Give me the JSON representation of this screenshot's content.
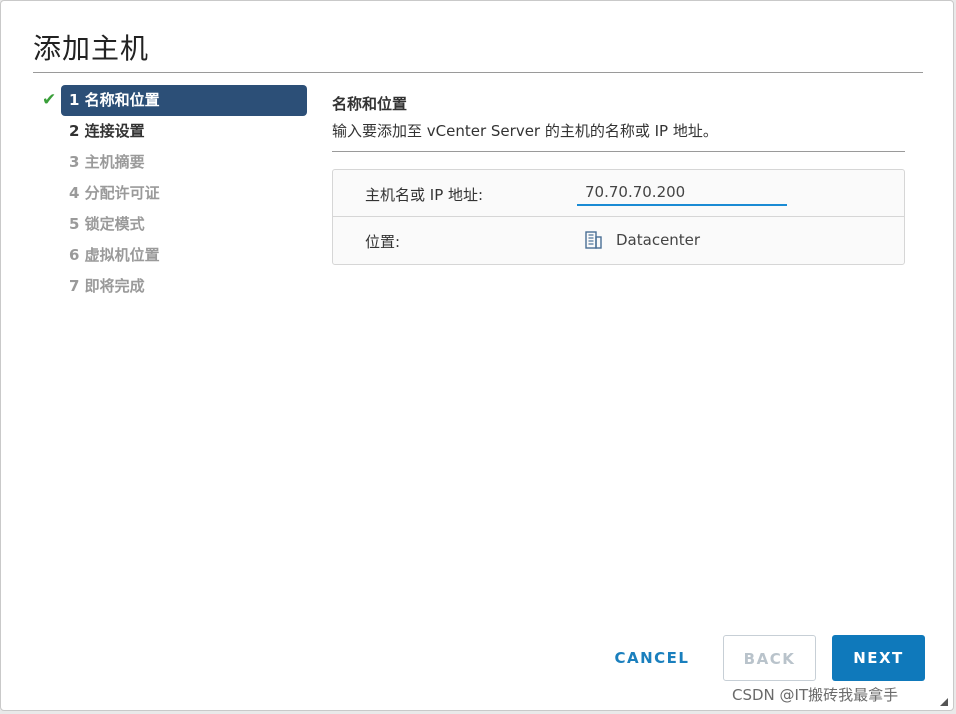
{
  "dialog": {
    "title": "添加主机"
  },
  "steps": [
    {
      "label": "1 名称和位置",
      "state": "active",
      "completed": true
    },
    {
      "label": "2 连接设置",
      "state": "enabled",
      "completed": false
    },
    {
      "label": "3 主机摘要",
      "state": "disabled",
      "completed": false
    },
    {
      "label": "4 分配许可证",
      "state": "disabled",
      "completed": false
    },
    {
      "label": "5 锁定模式",
      "state": "disabled",
      "completed": false
    },
    {
      "label": "6 虚拟机位置",
      "state": "disabled",
      "completed": false
    },
    {
      "label": "7 即将完成",
      "state": "disabled",
      "completed": false
    }
  ],
  "content": {
    "section_title": "名称和位置",
    "section_desc": "输入要添加至 vCenter Server 的主机的名称或 IP 地址。",
    "host_label": "主机名或 IP 地址:",
    "host_value": "70.70.70.200",
    "location_label": "位置:",
    "location_value": "Datacenter",
    "location_icon": "datacenter-icon"
  },
  "buttons": {
    "cancel": "CANCEL",
    "back": "BACK",
    "next": "NEXT"
  },
  "watermark": "CSDN @IT搬砖我最拿手",
  "colors": {
    "active_step_bg": "#2c4f77",
    "check_green": "#3a9f3a",
    "primary_button": "#0f79bb",
    "input_underline": "#1a8bd4"
  }
}
